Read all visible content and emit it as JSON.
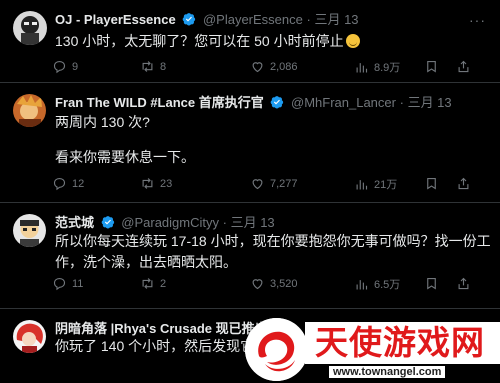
{
  "tweets": [
    {
      "name": "OJ - PlayerEssence",
      "handle": "@PlayerEssence",
      "sep": "·",
      "date": "三月 13",
      "text": "130 小时，太无聊了？您可以在 50 小时前停止",
      "text2": "",
      "replies": "9",
      "retweets": "8",
      "likes": "2,086",
      "views": "8.9万"
    },
    {
      "name": "Fran The WILD #Lance 首席执行官",
      "handle": "@MhFran_Lancer",
      "sep": "·",
      "date": "三月 13",
      "text": "两周内 130 次?",
      "text2": "看来你需要休息一下。",
      "replies": "12",
      "retweets": "23",
      "likes": "7,277",
      "views": "21万"
    },
    {
      "name": "范式城",
      "handle": "@ParadigmCityy",
      "sep": "·",
      "date": "三月 13",
      "text": "所以你每天连续玩 17-18 小时，现在你要抱怨你无事可做吗？找一份工作，洗个澡，出去晒晒太阳。",
      "text2": "",
      "replies": "11",
      "retweets": "2",
      "likes": "3,520",
      "views": "6.5万"
    },
    {
      "name": "阴暗角落 |Rhya's Crusade 现已推出",
      "handle": "",
      "sep": "",
      "date": "",
      "text": "你玩了 140 个小时，然后发现它很无",
      "text2": ""
    }
  ],
  "watermark": {
    "brand": "天使游戏网",
    "url": "www.townangel.com"
  },
  "colors": {
    "background": "#000000",
    "text": "#e7e9ea",
    "muted": "#71767b",
    "verified": "#1d9bf0",
    "divider": "#2f3336",
    "watermark_red": "#e0191b"
  },
  "icons": [
    "verified-badge-icon",
    "reply-icon",
    "retweet-icon",
    "like-icon",
    "views-icon",
    "bookmark-icon",
    "share-icon",
    "more-icon"
  ]
}
